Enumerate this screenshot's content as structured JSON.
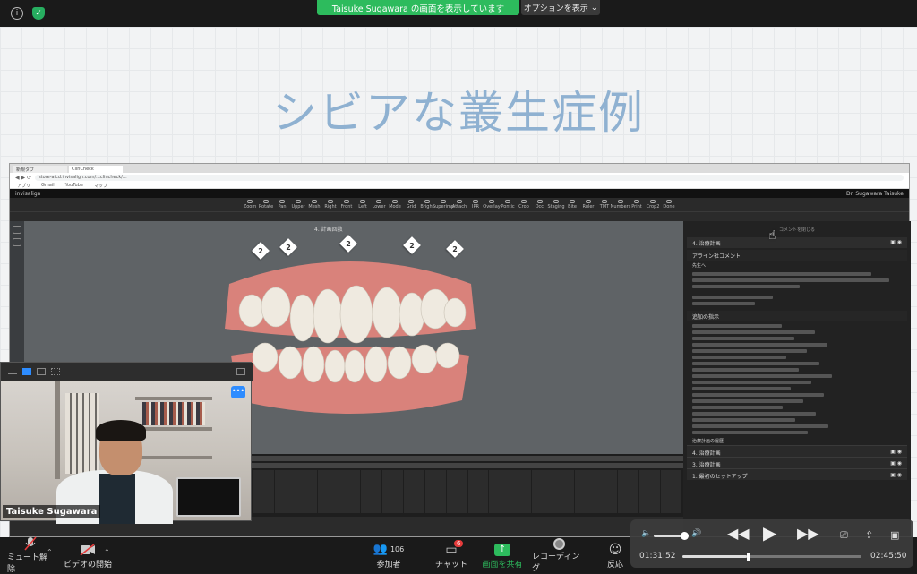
{
  "topbar": {
    "share_banner": "Taisuke Sugawara の画面を表示しています",
    "options_label": "オプションを表示",
    "options_caret": "⌄"
  },
  "slide": {
    "title": "シビアな叢生症例"
  },
  "shared_app": {
    "browser_tabs": [
      "新規タブ",
      "ClinCheck"
    ],
    "url": "store-aicd.invisalign.com/...clincheck/...",
    "bookmarks": [
      "アプリ",
      "Gmail",
      "YouTube",
      "マップ"
    ],
    "app_name": "invisalign",
    "user_name": "Dr. Sugawara Taisuke",
    "toolbar_tools": [
      "Zoom",
      "Rotate",
      "Pan",
      "Upper",
      "Mesh",
      "Right",
      "Front",
      "Left",
      "Lower",
      "Mode",
      "Grid",
      "Bright",
      "Superimp",
      "Attach",
      "IPR",
      "Overlay",
      "Pontic",
      "Crop",
      "Occl",
      "Staging",
      "Bite",
      "Ruler",
      "TMT",
      "Numbers",
      "Print",
      "Crop2",
      "Done"
    ],
    "stage_title": "4. 計画回数",
    "stage_badge_value": "2",
    "right_panel": {
      "top_label": "コメントを閉じる",
      "section_1": "4. 治療計画",
      "comment_header": "アライン社コメント",
      "greeting": "先生へ",
      "my_comment": "追加の指示",
      "sections": [
        "4. 治療計画",
        "3. 治療計画",
        "1. 最初のセットアップ"
      ],
      "history_label": "治療計画の履歴"
    }
  },
  "video_tile": {
    "participant_name": "Taisuke Sugawara",
    "more_label": "•••"
  },
  "bottombar": {
    "mute_label": "ミュート解除",
    "video_label": "ビデオの開始",
    "participants_label": "参加者",
    "participants_count": "106",
    "chat_label": "チャット",
    "chat_badge": "6",
    "share_label": "画面を共有",
    "record_label": "レコーディング",
    "reaction_label": "反応"
  },
  "media": {
    "elapsed": "01:31:52",
    "remaining": "02:45:50",
    "progress_percent": 35.8,
    "volume_percent": 85
  },
  "icons": {
    "info": "info-icon",
    "shield": "shield-icon",
    "mute": "microphone-muted-icon",
    "video": "video-off-icon",
    "participants": "people-icon",
    "chat": "chat-bubble-icon",
    "share": "share-screen-icon",
    "record": "record-icon",
    "reaction": "smiley-icon"
  }
}
